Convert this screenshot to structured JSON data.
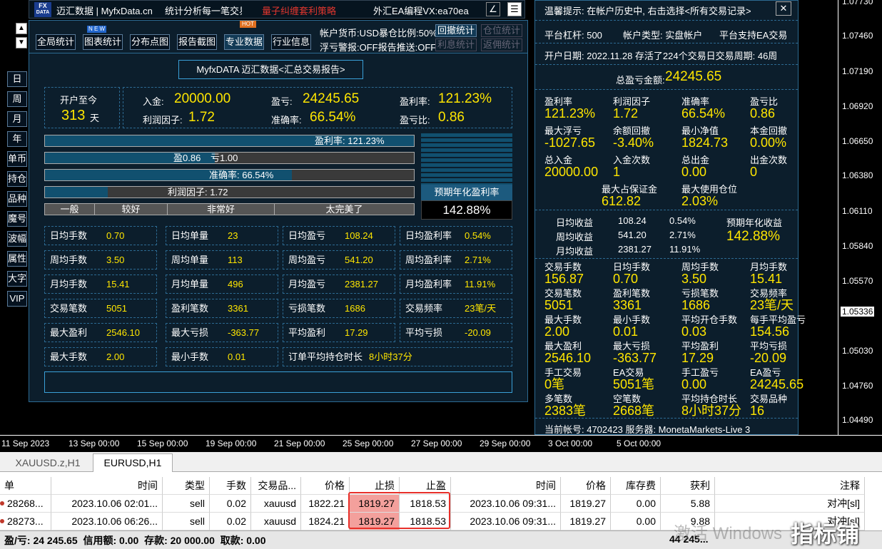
{
  "toolbar": {
    "title": "迈汇数据 | MyfxData.cn",
    "slogan": "统计分析每一笔交易",
    "promo": "量子纠缠套利策略",
    "contact": "外汇EA编程VX:ea70ea",
    "pen": "∠",
    "menu": "☰",
    "logo_top": "FX",
    "logo_bottom": "DATA"
  },
  "nav": {
    "items": [
      "全局统计",
      "图表统计",
      "分布点图",
      "报告截图",
      "专业数据",
      "行业信息"
    ],
    "badge_new": "N E W",
    "badge_hot": "HOT",
    "up": "▲",
    "down": "▼"
  },
  "account": {
    "line1": "帐户货币:USD暴仓比例:50%",
    "btn_retrace": "回撤统计",
    "btn_position": "仓位统计",
    "line2": "浮亏警报:OFF报告推送:OFF",
    "btn_profit_retrace": "利息统计",
    "btn_return_profit": "返佣统计"
  },
  "report_title": "MyfxDATA 迈汇数据<汇总交易报告>",
  "since": {
    "label": "开户至今",
    "days": "313",
    "unit": "天"
  },
  "summary": {
    "deposit_k": "入金:",
    "deposit_v": "20000.00",
    "profit_k": "盈亏:",
    "profit_v": "24245.65",
    "rate_k": "盈利率:",
    "rate_v": "121.23%",
    "pf_k": "利润因子:",
    "pf_v": "1.72",
    "acc_k": "准确率:",
    "acc_v": "66.54%",
    "ratio_k": "盈亏比:",
    "ratio_v": "0.86"
  },
  "bars": {
    "b1": "盈利率: 121.23%",
    "b2a": "盈0.86",
    "b2b": "亏1.00",
    "b3": "准确率: 66.54%",
    "b4": "利润因子: 1.72",
    "scale": [
      "一般",
      "较好",
      "非常好",
      "太完美了"
    ],
    "b1_fill": 1.0,
    "b2_fill": 0.46,
    "b3_fill": 0.67,
    "b4_fill": 0.17
  },
  "annual": {
    "label": "预期年化盈利率",
    "value": "142.88%"
  },
  "grid": [
    [
      "日均手数",
      "0.70",
      "日均单量",
      "23",
      "日均盈亏",
      "108.24",
      "日均盈利率",
      "0.54%"
    ],
    [
      "周均手数",
      "3.50",
      "周均单量",
      "113",
      "周均盈亏",
      "541.20",
      "周均盈利率",
      "2.71%"
    ],
    [
      "月均手数",
      "15.41",
      "月均单量",
      "496",
      "月均盈亏",
      "2381.27",
      "月均盈利率",
      "11.91%"
    ],
    [
      "交易笔数",
      "5051",
      "盈利笔数",
      "3361",
      "亏损笔数",
      "1686",
      "交易频率",
      "23笔/天"
    ],
    [
      "最大盈利",
      "2546.10",
      "最大亏损",
      "-363.77",
      "平均盈利",
      "17.29",
      "平均亏损",
      "-20.09"
    ]
  ],
  "last_row": {
    "k1": "最大手数",
    "v1": "2.00",
    "k2": "最小手数",
    "v2": "0.01",
    "k3": "订单平均持仓时长",
    "v3": "8小时37分"
  },
  "left_tabs": [
    "日",
    "周",
    "月",
    "年",
    "单币",
    "持仓",
    "品种",
    "魔号",
    "波幅",
    "属性",
    "大字",
    "VIP"
  ],
  "right": {
    "tip": "温馨提示: 在帐户历史中, 右击选择<所有交易记录>",
    "close": "✕",
    "leverage": "平台杠杆: 500",
    "acctype": "帐户类型: 实盘帐户",
    "ea": "平台支持EA交易",
    "opened": "开户日期: 2022.11.28 存活了224个交易日交易周期: 46周",
    "total_k": "总盈亏金额:",
    "total_v": "24245.65",
    "s1": [
      [
        "盈利率",
        "121.23%"
      ],
      [
        "利润因子",
        "1.72"
      ],
      [
        "准确率",
        "66.54%"
      ],
      [
        "盈亏比",
        "0.86"
      ]
    ],
    "s2": [
      [
        "最大浮亏",
        "-1027.65"
      ],
      [
        "余额回撤",
        "-3.40%"
      ],
      [
        "最小净值",
        "1824.73"
      ],
      [
        "本金回撤",
        "0.00%"
      ]
    ],
    "s3": [
      [
        "总入金",
        "20000.00"
      ],
      [
        "入金次数",
        "1"
      ],
      [
        "总出金",
        "0.00"
      ],
      [
        "出金次数",
        "0"
      ]
    ],
    "s4": [
      [
        "最大占保证金",
        "612.82"
      ],
      [
        "最大使用仓位",
        "2.03%"
      ]
    ],
    "inc": [
      [
        "日均收益",
        "108.24",
        "0.54%"
      ],
      [
        "周均收益",
        "541.20",
        "2.71%"
      ],
      [
        "月均收益",
        "2381.27",
        "11.91%"
      ]
    ],
    "inc_annual_k": "预期年化收益",
    "inc_annual_v": "142.88%",
    "s5": [
      [
        "交易手数",
        "156.87"
      ],
      [
        "日均手数",
        "0.70"
      ],
      [
        "周均手数",
        "3.50"
      ],
      [
        "月均手数",
        "15.41"
      ]
    ],
    "s6": [
      [
        "交易笔数",
        "5051"
      ],
      [
        "盈利笔数",
        "3361"
      ],
      [
        "亏损笔数",
        "1686"
      ],
      [
        "交易频率",
        "23笔/天"
      ]
    ],
    "s7": [
      [
        "最大手数",
        "2.00"
      ],
      [
        "最小手数",
        "0.01"
      ],
      [
        "平均开仓手数",
        "0.03"
      ],
      [
        "每手平均盈亏",
        "154.56"
      ]
    ],
    "s8": [
      [
        "最大盈利",
        "2546.10"
      ],
      [
        "最大亏损",
        "-363.77"
      ],
      [
        "平均盈利",
        "17.29"
      ],
      [
        "平均亏损",
        "-20.09"
      ]
    ],
    "s9": [
      [
        "手工交易",
        "0笔"
      ],
      [
        "EA交易",
        "5051笔"
      ],
      [
        "手工盈亏",
        "0.00"
      ],
      [
        "EA盈亏",
        "24245.65"
      ]
    ],
    "s10": [
      [
        "多笔数",
        "2383笔"
      ],
      [
        "空笔数",
        "2668笔"
      ],
      [
        "平均持仓时长",
        "8小时37分"
      ],
      [
        "交易品种",
        "16"
      ]
    ],
    "footer": "当前帐号: 4702423 服务器: MonetaMarkets-Live 3"
  },
  "prices": [
    "1.07730",
    "1.07460",
    "1.07190",
    "1.06920",
    "1.06650",
    "1.06380",
    "1.06110",
    "1.05840",
    "1.05570",
    "1.05336",
    "1.05030",
    "1.04760",
    "1.04490"
  ],
  "price_current": "1.05336",
  "dates": [
    "11 Sep 2023",
    "13 Sep 00:00",
    "15 Sep 00:00",
    "19 Sep 00:00",
    "21 Sep 00:00",
    "25 Sep 00:00",
    "27 Sep 00:00",
    "29 Sep 00:00",
    "3 Oct 00:00",
    "5 Oct 00:00"
  ],
  "tabs": [
    "XAUUSD.z,H1",
    "EURUSD,H1"
  ],
  "table": {
    "headers": [
      "单",
      "时间",
      "类型",
      "手数",
      "交易品...",
      "价格",
      "止损",
      "止盈",
      "时间",
      "价格",
      "库存费",
      "获利",
      "注释"
    ],
    "rows": [
      [
        "28268...",
        "2023.10.06 02:01...",
        "sell",
        "0.02",
        "xauusd",
        "1822.21",
        "1819.27",
        "1818.53",
        "2023.10.06 09:31...",
        "1819.27",
        "0.00",
        "5.88",
        "对冲[sl]"
      ],
      [
        "28273...",
        "2023.10.06 06:26...",
        "sell",
        "0.02",
        "xauusd",
        "1824.21",
        "1819.27",
        "1818.53",
        "2023.10.06 09:31...",
        "1819.27",
        "0.00",
        "9.88",
        "对冲[sl]"
      ]
    ],
    "summary": "盈/亏: 24 245.65  信用额: 0.00  存款: 20 000.00  取款: 0.00",
    "total": "44 245..."
  },
  "watermark": "激活 Windows",
  "brand": "指标铺"
}
